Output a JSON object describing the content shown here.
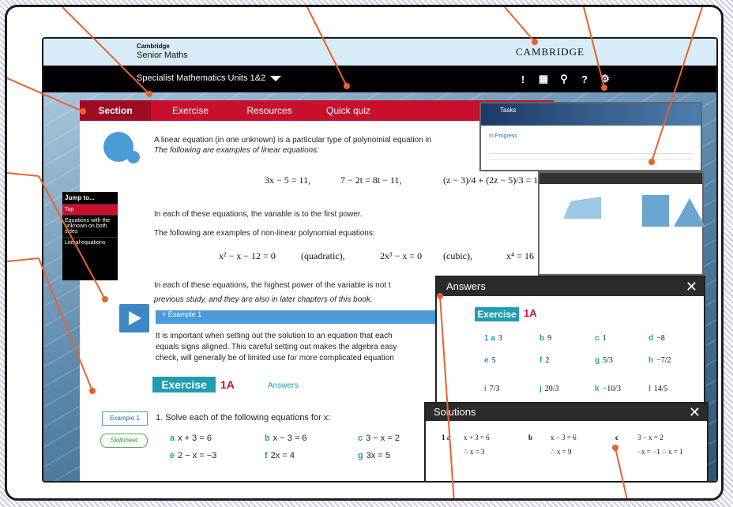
{
  "app": {
    "brand_small": "Cambridge",
    "brand_name": "Senior Maths",
    "publisher": "CAMBRIDGE",
    "course": "Specialist Mathematics Units 1&2"
  },
  "nav_icons": [
    "feedback-icon",
    "apps-grid-icon",
    "search-icon",
    "help-icon",
    "gear-icon"
  ],
  "tabs": [
    "Section",
    "Exercise",
    "Resources",
    "Quick quiz"
  ],
  "intro": {
    "line1": "A linear equation (in one unknown) is a particular type of polynomial equation in",
    "line2": "The following are examples of linear equations:",
    "eq1": "3x − 5 = 11,",
    "eq2": "7 − 2t = 8t − 11,",
    "eq3": "(z − 3)/4 + (2z − 5)/3 = 1",
    "para2": "In each of these equations, the variable is to the first power.",
    "para3": "The following are examples of non-linear polynomial equations:",
    "nl1": "x² − x − 12 = 0",
    "nl1b": "(quadratic),",
    "nl2": "2x³ − x = 0",
    "nl2b": "(cubic),",
    "nl3": "x⁴ = 16",
    "para4": "In each of these equations, the highest power of the variable is not t",
    "para5": "previous study, and they are also in later chapters of this book."
  },
  "jump": {
    "title": "Jump to...",
    "items": [
      "Top",
      "Equations with the unknown on both sides",
      "Literal equations"
    ]
  },
  "example_bar": "+ Example 1",
  "para6": [
    "It is important when setting out the solution to an equation that each",
    "equals signs aligned. This careful setting out makes the algebra easy",
    "check, will generally be of limited use for more complicated equation"
  ],
  "exercise": {
    "button": "Exercise",
    "code": "1A",
    "answers_link": "Answers"
  },
  "badges": {
    "example": "Example 1",
    "skillsheet": "Skillsheet"
  },
  "question": "1. Solve each of the following equations for x:",
  "parts": [
    {
      "l": "a",
      "e": "x + 3 = 6"
    },
    {
      "l": "b",
      "e": "x − 3 = 6"
    },
    {
      "l": "c",
      "e": "3 − x = 2"
    },
    {
      "l": "e",
      "e": "2 − x = −3"
    },
    {
      "l": "f",
      "e": "2x = 4"
    },
    {
      "l": "g",
      "e": "3x = 5"
    }
  ],
  "answers_panel": {
    "title": "Answers",
    "exercise": "Exercise",
    "code": "1A",
    "items": [
      {
        "l": "1 a",
        "v": "3"
      },
      {
        "l": "b",
        "v": "9"
      },
      {
        "l": "c",
        "v": "1"
      },
      {
        "l": "d",
        "v": "−8"
      },
      {
        "l": "e",
        "v": "5"
      },
      {
        "l": "f",
        "v": "2"
      },
      {
        "l": "g",
        "v": "5/3"
      },
      {
        "l": "h",
        "v": "−7/2"
      },
      {
        "l": "i",
        "v": "7/3"
      },
      {
        "l": "j",
        "v": "20/3"
      },
      {
        "l": "k",
        "v": "−10/3"
      },
      {
        "l": "l",
        "v": "14/5"
      }
    ]
  },
  "solutions_panel": {
    "title": "Solutions",
    "rows": [
      {
        "l": "1 a",
        "s1": "x + 3 = 6",
        "s2": "∴ x = 3"
      },
      {
        "l": "b",
        "s1": "x − 3 = 6",
        "s2": "∴ x = 9"
      },
      {
        "l": "c",
        "s1": "3 − x = 2",
        "s2": "−x = −1  ∴ x = 1"
      }
    ]
  },
  "tasks_panel": {
    "title": "Tasks",
    "status": "In Progress"
  },
  "colors": {
    "accent_red": "#c8102e",
    "teal": "#1f9db3",
    "blue": "#4a9bd6",
    "callout": "#e8622a"
  }
}
